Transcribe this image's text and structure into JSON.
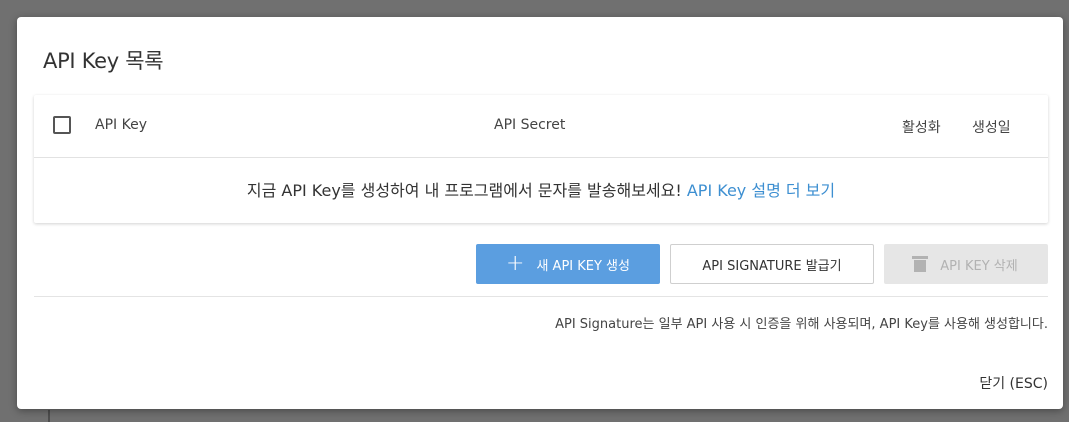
{
  "modal": {
    "title": "API Key 목록",
    "close_label": "닫기 (ESC)"
  },
  "table": {
    "columns": [
      "API Key",
      "API Secret",
      "활성화",
      "생성일"
    ],
    "empty_message": "지금 API Key를 생성하여 내 프로그램에서 문자를 발송해보세요! ",
    "empty_link": "API Key 설명 더 보기"
  },
  "actions": {
    "new_key_label": "새 API KEY 생성",
    "new_key_icon": "plus-icon",
    "signature_label": "API SIGNATURE 발급기",
    "delete_label": "API KEY 삭제",
    "delete_icon": "trash-icon"
  },
  "note": "API Signature는 일부 API 사용 시 인증을 위해 사용되며, API Key를 사용해 생성합니다.",
  "colors": {
    "primary": "#5b9ee0",
    "link": "#3d8fd1",
    "disabled_bg": "#e6e6e6",
    "overlay": "#707070"
  }
}
